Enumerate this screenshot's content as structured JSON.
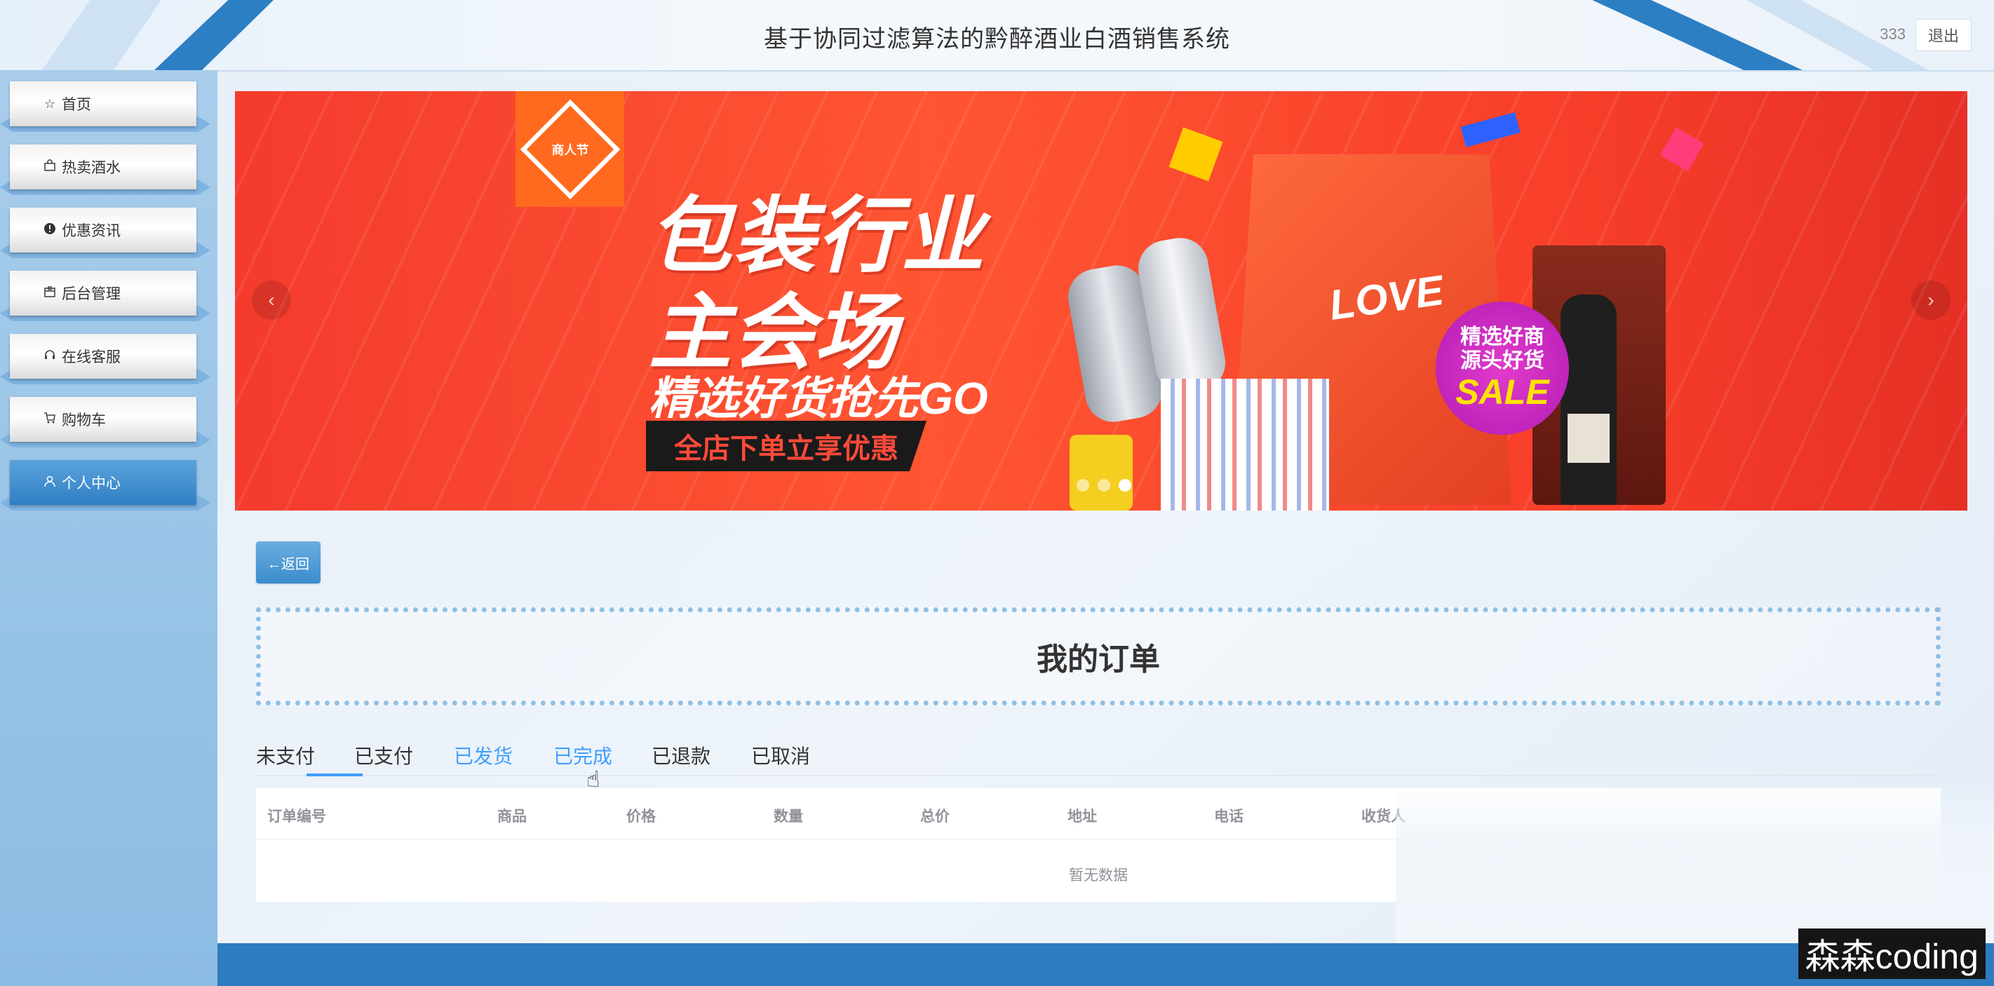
{
  "header": {
    "title": "基于协同过滤算法的黔醉酒业白酒销售系统",
    "username": "333",
    "logout_label": "退出"
  },
  "sidebar": {
    "items": [
      {
        "label": "首页",
        "icon": "star-icon",
        "active": false
      },
      {
        "label": "热卖酒水",
        "icon": "bag-icon",
        "active": false
      },
      {
        "label": "优惠资讯",
        "icon": "info-icon",
        "active": false
      },
      {
        "label": "后台管理",
        "icon": "box-icon",
        "active": false
      },
      {
        "label": "在线客服",
        "icon": "headset-icon",
        "active": false
      },
      {
        "label": "购物车",
        "icon": "cart-icon",
        "active": false
      },
      {
        "label": "个人中心",
        "icon": "user-icon",
        "active": true
      }
    ]
  },
  "banner": {
    "logo_text": "商人节",
    "line1": "包装行业",
    "line2": "主会场",
    "line3": "精选好货抢先GO",
    "cta": "全店下单立享优惠",
    "bag_text": "LOVE",
    "badge_line1": "精选好商",
    "badge_line2": "源头好货",
    "badge_sale": "SALE",
    "slide_count": 3,
    "active_slide": 3
  },
  "back_button_label": "←返回",
  "page_title": "我的订单",
  "tabs": [
    {
      "label": "未支付",
      "active": true,
      "blue": false
    },
    {
      "label": "已支付",
      "active": false,
      "blue": false
    },
    {
      "label": "已发货",
      "active": false,
      "blue": true
    },
    {
      "label": "已完成",
      "active": false,
      "blue": true
    },
    {
      "label": "已退款",
      "active": false,
      "blue": false
    },
    {
      "label": "已取消",
      "active": false,
      "blue": false
    }
  ],
  "table": {
    "columns": [
      "订单编号",
      "商品",
      "价格",
      "数量",
      "总价",
      "地址",
      "电话",
      "收货人"
    ],
    "empty_text": "暂无数据"
  },
  "watermark": "森森coding",
  "colors": {
    "accent": "#409eff",
    "sidebar_active": "#2f7fc3",
    "header_stripe": "#2d7fc3",
    "banner_red": "#f43b2d"
  }
}
